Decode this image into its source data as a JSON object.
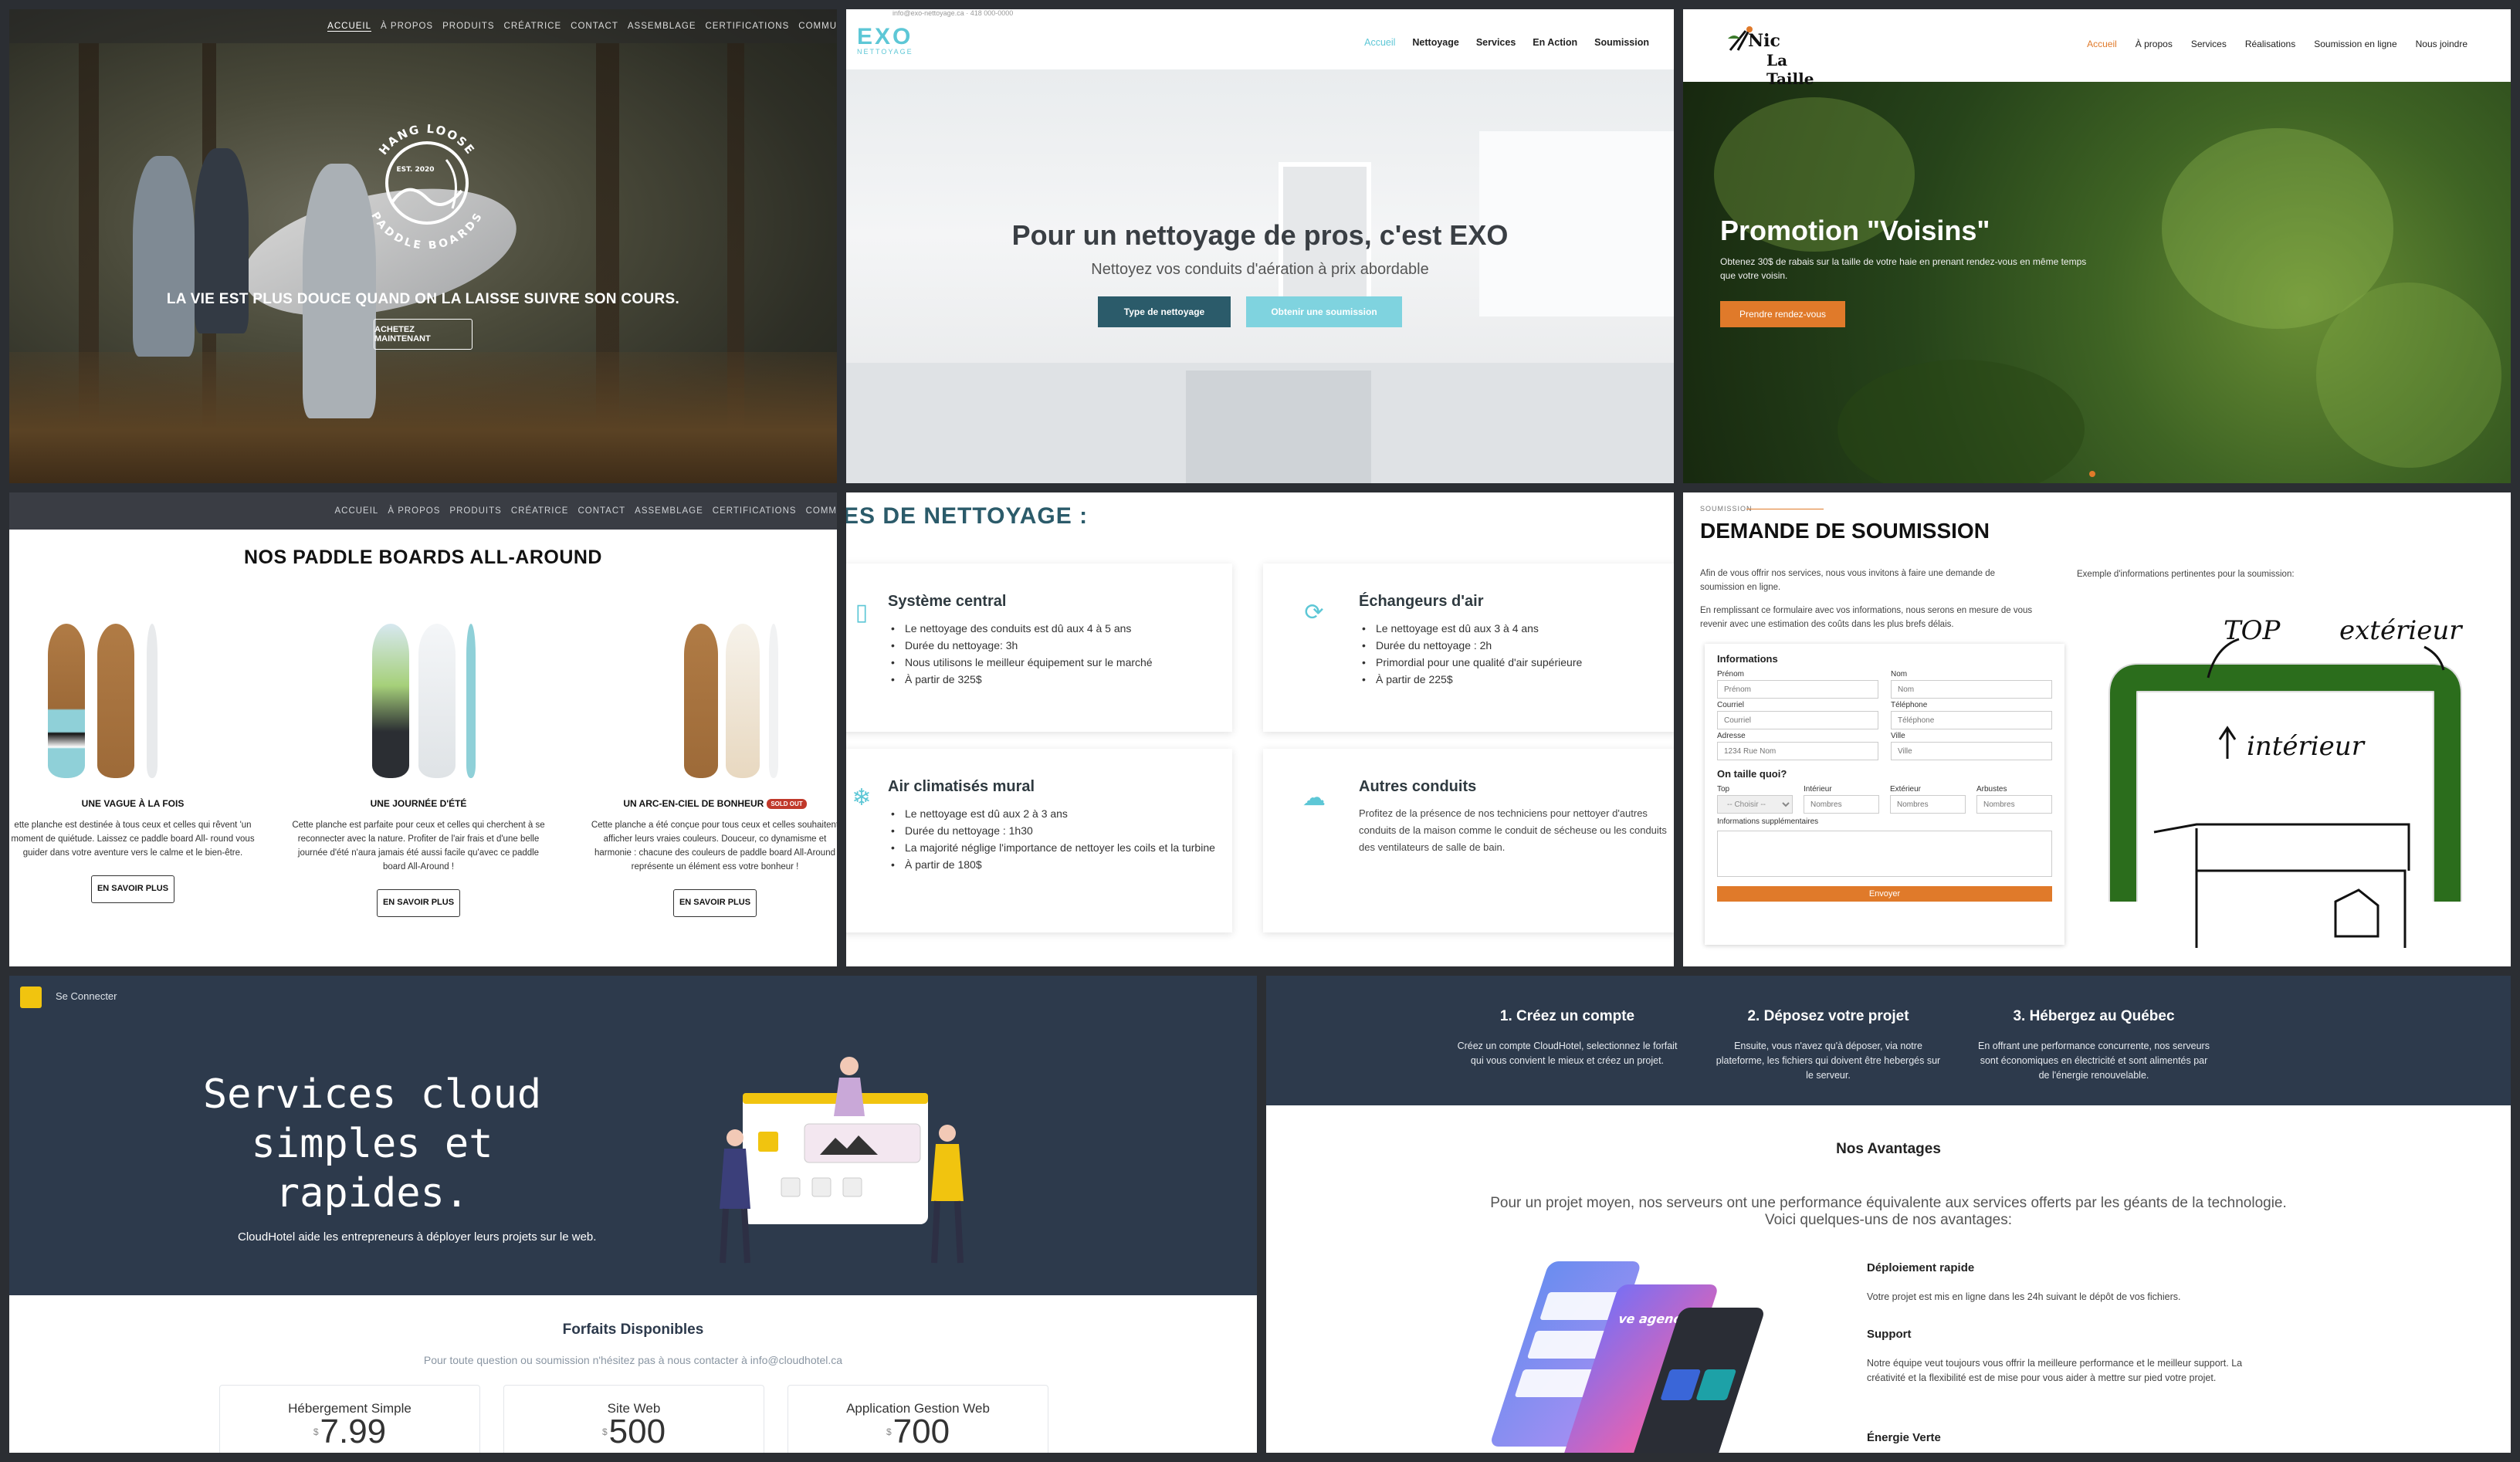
{
  "hangloose": {
    "nav": [
      "ACCUEIL",
      "À PROPOS",
      "PRODUITS",
      "CRÉATRICE",
      "CONTACT",
      "ASSEMBLAGE",
      "CERTIFICATIONS",
      "COMMU"
    ],
    "logo_top": "HANG LOOSE",
    "logo_est": "EST. 2020",
    "logo_bottom": "PADDLE BOARDS",
    "tagline": "LA VIE EST PLUS DOUCE QUAND ON LA LAISSE SUIVRE SON COURS.",
    "cta": "ACHETEZ MAINTENANT"
  },
  "exo": {
    "topline": "info@exo-nettoyage.ca   ·   418 000-0000",
    "logo": "EXO",
    "logo_sub": "NETTOYAGE",
    "nav": [
      "Accueil",
      "Nettoyage",
      "Services",
      "En Action",
      "Soumission"
    ],
    "title": "Pour un nettoyage de pros, c'est EXO",
    "subtitle": "Nettoyez vos conduits d'aération à prix abordable",
    "btn_primary": "Type de nettoyage",
    "btn_secondary": "Obtenir une soumission"
  },
  "nictaille": {
    "logo_line1": "Nic",
    "logo_line2": "La Taille",
    "nav": [
      "Accueil",
      "À propos",
      "Services",
      "Réalisations",
      "Soumission en ligne",
      "Nous joindre"
    ],
    "title": "Promotion \"Voisins\"",
    "subtitle": "Obtenez 30$ de rabais sur la taille de votre haie en prenant rendez-vous en même temps que votre voisin.",
    "cta": "Prendre rendez-vous"
  },
  "paddle_products": {
    "nav": [
      "ACCUEIL",
      "À PROPOS",
      "PRODUITS",
      "CRÉATRICE",
      "CONTACT",
      "ASSEMBLAGE",
      "CERTIFICATIONS",
      "COMM"
    ],
    "title": "NOS PADDLE BOARDS ALL-AROUND",
    "items": [
      {
        "name": "UNE VAGUE À LA FOIS",
        "desc": "ette planche est destinée à tous ceux et celles qui rêvent 'un moment de quiétude. Laissez ce paddle board All- round vous guider dans votre aventure vers le calme et le bien-être.",
        "more": "EN SAVOIR PLUS"
      },
      {
        "name": "UNE JOURNÉE D'ÉTÉ",
        "desc": "Cette planche est parfaite pour ceux et celles qui cherchent à se reconnecter avec la nature. Profiter de l'air frais et d'une belle journée d'été n'aura jamais été aussi facile qu'avec ce paddle board All-Around !",
        "more": "EN SAVOIR PLUS"
      },
      {
        "name": "UN ARC-EN-CIEL DE BONHEUR",
        "badge": "SOLD OUT",
        "desc": "Cette planche a été conçue pour tous ceux et celles souhaitent afficher leurs vraies couleurs. Douceur, co dynamisme et harmonie : chacune des couleurs de paddle board All-Around représente un élément ess votre bonheur !",
        "more": "EN SAVOIR PLUS"
      }
    ]
  },
  "exo_services": {
    "title": "ES DE NETTOYAGE :",
    "cards": [
      {
        "title": "Système central",
        "icon": "vent-icon",
        "items": [
          "Le nettoyage des conduits est dû aux 4 à 5 ans",
          "Durée du nettoyage: 3h",
          "Nous utilisons le meilleur équipement sur le marché",
          "À partir de 325$"
        ]
      },
      {
        "title": "Échangeurs d'air",
        "icon": "recycle-icon",
        "items": [
          "Le nettoyage est dû aux 3 à 4 ans",
          "Durée du nettoyage : 2h",
          "Primordial pour une qualité d'air supérieure",
          "À partir de 225$"
        ]
      },
      {
        "title": "Air climatisés mural",
        "icon": "snowflake-icon",
        "items": [
          "Le nettoyage est dû aux 2 à 3 ans",
          "Durée du nettoyage : 1h30",
          "La majorité néglige l'importance de nettoyer les coils et la turbine",
          "À partir de 180$"
        ]
      },
      {
        "title": "Autres conduits",
        "icon": "cloud-icon",
        "text": "Profitez de la présence de nos techniciens pour nettoyer d'autres conduits de la maison comme le conduit de sécheuse ou les conduits des ventilateurs de salle de bain."
      }
    ]
  },
  "soumission": {
    "kicker": "SOUMISSION",
    "title": "DEMANDE DE SOUMISSION",
    "intro1": "Afin de vous offrir nos services, nous vous invitons à faire une demande de soumission en ligne.",
    "intro2": "En remplissant ce formulaire avec vos informations, nous serons en mesure de vous revenir avec une estimation des coûts dans les plus brefs délais.",
    "form_title": "Informations",
    "prenom_label": "Prénom",
    "prenom_ph": "Prénom",
    "nom_label": "Nom",
    "nom_ph": "Nom",
    "courriel_label": "Courriel",
    "courriel_ph": "Courriel",
    "tel_label": "Téléphone",
    "tel_ph": "Téléphone",
    "adresse_label": "Adresse",
    "adresse_ph": "1234 Rue Nom",
    "ville_label": "Ville",
    "ville_ph": "Ville",
    "taille_title": "On taille quoi?",
    "top_label": "Top",
    "top_value": "-- Choisir --",
    "int_label": "Intérieur",
    "int_ph": "Nombres",
    "ext_label": "Extérieur",
    "ext_ph": "Nombres",
    "arb_label": "Arbustes",
    "arb_ph": "Nombres",
    "extra_label": "Informations supplémentaires",
    "send": "Envoyer",
    "example": "Exemple d'informations pertinentes pour la soumission:",
    "sketch_top": "TOP",
    "sketch_ext": "extérieur",
    "sketch_int": "intérieur"
  },
  "cloudhotel": {
    "connect": "Se Connecter",
    "title_lines": [
      "Services cloud",
      "simples et",
      "rapides."
    ],
    "subtitle": "CloudHotel aide les entrepreneurs à déployer leurs projets sur le web.",
    "plans_title": "Forfaits Disponibles",
    "plans_sub": "Pour toute question ou soumission n'hésitez pas à nous contacter à info@cloudhotel.ca",
    "plans": [
      {
        "name": "Hébergement Simple",
        "currency": "$",
        "price": "7.99"
      },
      {
        "name": "Site Web",
        "currency": "$",
        "price": "500"
      },
      {
        "name": "Application Gestion Web",
        "currency": "$",
        "price": "700"
      }
    ]
  },
  "cloudhotel_steps": {
    "steps": [
      {
        "title": "1. Créez un compte",
        "text": "Créez un compte CloudHotel, selectionnez le forfait qui vous convient le mieux et créez un projet."
      },
      {
        "title": "2. Déposez votre projet",
        "text": "Ensuite, vous n'avez qu'à déposer, via notre plateforme, les fichiers qui doivent être hebergés sur le serveur."
      },
      {
        "title": "3. Hébergez au Québec",
        "text": "En offrant une performance concurrente, nos serveurs sont économiques en électricité et sont alimentés par de l'énergie renouvelable."
      }
    ],
    "adv_title": "Nos Avantages",
    "adv_sub1": "Pour un projet moyen, nos serveurs ont une performance équivalente aux services offerts par les géants de la technologie.",
    "adv_sub2": "Voici quelques-uns de nos avantages:",
    "features": [
      {
        "title": "Déploiement rapide",
        "text": "Votre projet est mis en ligne dans les 24h suivant le dépôt de vos fichiers."
      },
      {
        "title": "Support",
        "text": "Notre équipe veut toujours vous offrir la meilleure performance et le meilleur support. La créativité et la flexibilité est de mise pour vous aider à mettre sur pied votre projet."
      },
      {
        "title": "Énergie Verte",
        "text": ""
      }
    ],
    "phone_text": "ve agency"
  }
}
